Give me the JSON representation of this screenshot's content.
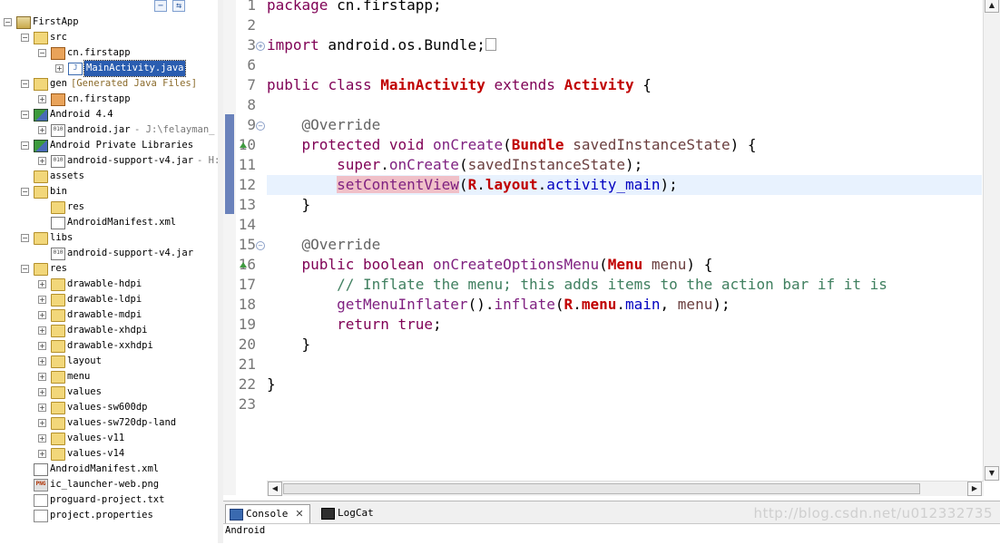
{
  "explorer": {
    "items": [
      {
        "label": "FirstApp",
        "depth": 0,
        "exp": "-",
        "icon": "project-icon",
        "cls": "i-proj"
      },
      {
        "label": "src",
        "depth": 1,
        "exp": "-",
        "icon": "source-folder-icon",
        "cls": "i-srcfolder"
      },
      {
        "label": "cn.firstapp",
        "depth": 2,
        "exp": "-",
        "icon": "package-icon",
        "cls": "i-pkg"
      },
      {
        "label": "MainActivity.java",
        "depth": 3,
        "exp": "+",
        "icon": "java-file-icon",
        "cls": "i-java",
        "selected": true
      },
      {
        "label": "gen",
        "depth": 1,
        "exp": "-",
        "icon": "source-folder-icon",
        "cls": "i-srcfolder",
        "decoration": "[Generated Java Files]"
      },
      {
        "label": "cn.firstapp",
        "depth": 2,
        "exp": "+",
        "icon": "package-icon",
        "cls": "i-pkg"
      },
      {
        "label": "Android 4.4",
        "depth": 1,
        "exp": "-",
        "icon": "library-icon",
        "cls": "i-lib"
      },
      {
        "label": "android.jar",
        "depth": 2,
        "exp": "+",
        "icon": "jar-icon",
        "cls": "i-jar",
        "decoration": "- J:\\felayman_"
      },
      {
        "label": "Android Private Libraries",
        "depth": 1,
        "exp": "-",
        "icon": "library-icon",
        "cls": "i-lib"
      },
      {
        "label": "android-support-v4.jar",
        "depth": 2,
        "exp": "+",
        "icon": "jar-icon",
        "cls": "i-jar",
        "decoration": "- H:"
      },
      {
        "label": "assets",
        "depth": 1,
        "exp": "",
        "icon": "folder-icon",
        "cls": "i-folder"
      },
      {
        "label": "bin",
        "depth": 1,
        "exp": "-",
        "icon": "folder-icon",
        "cls": "i-folder"
      },
      {
        "label": "res",
        "depth": 2,
        "exp": "",
        "icon": "folder-icon",
        "cls": "i-folder"
      },
      {
        "label": "AndroidManifest.xml",
        "depth": 2,
        "exp": "",
        "icon": "xml-file-icon",
        "cls": "i-xml"
      },
      {
        "label": "libs",
        "depth": 1,
        "exp": "-",
        "icon": "folder-icon",
        "cls": "i-folder"
      },
      {
        "label": "android-support-v4.jar",
        "depth": 2,
        "exp": "",
        "icon": "jar-icon",
        "cls": "i-jar"
      },
      {
        "label": "res",
        "depth": 1,
        "exp": "-",
        "icon": "folder-icon",
        "cls": "i-folder"
      },
      {
        "label": "drawable-hdpi",
        "depth": 2,
        "exp": "+",
        "icon": "folder-icon",
        "cls": "i-folder"
      },
      {
        "label": "drawable-ldpi",
        "depth": 2,
        "exp": "+",
        "icon": "folder-icon",
        "cls": "i-folder"
      },
      {
        "label": "drawable-mdpi",
        "depth": 2,
        "exp": "+",
        "icon": "folder-icon",
        "cls": "i-folder"
      },
      {
        "label": "drawable-xhdpi",
        "depth": 2,
        "exp": "+",
        "icon": "folder-icon",
        "cls": "i-folder"
      },
      {
        "label": "drawable-xxhdpi",
        "depth": 2,
        "exp": "+",
        "icon": "folder-icon",
        "cls": "i-folder"
      },
      {
        "label": "layout",
        "depth": 2,
        "exp": "+",
        "icon": "folder-icon",
        "cls": "i-folder"
      },
      {
        "label": "menu",
        "depth": 2,
        "exp": "+",
        "icon": "folder-icon",
        "cls": "i-folder"
      },
      {
        "label": "values",
        "depth": 2,
        "exp": "+",
        "icon": "folder-icon",
        "cls": "i-folder"
      },
      {
        "label": "values-sw600dp",
        "depth": 2,
        "exp": "+",
        "icon": "folder-icon",
        "cls": "i-folder"
      },
      {
        "label": "values-sw720dp-land",
        "depth": 2,
        "exp": "+",
        "icon": "folder-icon",
        "cls": "i-folder"
      },
      {
        "label": "values-v11",
        "depth": 2,
        "exp": "+",
        "icon": "folder-icon",
        "cls": "i-folder"
      },
      {
        "label": "values-v14",
        "depth": 2,
        "exp": "+",
        "icon": "folder-icon",
        "cls": "i-folder"
      },
      {
        "label": "AndroidManifest.xml",
        "depth": 1,
        "exp": "",
        "icon": "xml-file-icon",
        "cls": "i-xml"
      },
      {
        "label": "ic_launcher-web.png",
        "depth": 1,
        "exp": "",
        "icon": "png-file-icon",
        "cls": "i-png"
      },
      {
        "label": "proguard-project.txt",
        "depth": 1,
        "exp": "",
        "icon": "text-file-icon",
        "cls": "i-file"
      },
      {
        "label": "project.properties",
        "depth": 1,
        "exp": "",
        "icon": "text-file-icon",
        "cls": "i-file"
      }
    ]
  },
  "editor": {
    "lines": [
      {
        "n": "1",
        "tokens": [
          {
            "t": "package",
            "c": "kw"
          },
          {
            "t": " cn.firstapp;"
          }
        ]
      },
      {
        "n": "2",
        "tokens": []
      },
      {
        "n": "3",
        "fold": "+",
        "tokens": [
          {
            "t": "import",
            "c": "kw"
          },
          {
            "t": " android.os.Bundle;"
          },
          {
            "t": "",
            "c": "box"
          }
        ]
      },
      {
        "n": "6",
        "tokens": []
      },
      {
        "n": "7",
        "tokens": [
          {
            "t": "public",
            "c": "kw"
          },
          {
            "t": " "
          },
          {
            "t": "class",
            "c": "kw"
          },
          {
            "t": " "
          },
          {
            "t": "MainActivity",
            "c": "ty"
          },
          {
            "t": " "
          },
          {
            "t": "extends",
            "c": "kw"
          },
          {
            "t": " "
          },
          {
            "t": "Activity",
            "c": "ty"
          },
          {
            "t": " {"
          }
        ]
      },
      {
        "n": "8",
        "tokens": []
      },
      {
        "n": "9",
        "fold": "-",
        "tokens": [
          {
            "t": "    "
          },
          {
            "t": "@Override",
            "c": "an"
          }
        ]
      },
      {
        "n": "10",
        "tri": true,
        "tokens": [
          {
            "t": "    "
          },
          {
            "t": "protected",
            "c": "kw"
          },
          {
            "t": " "
          },
          {
            "t": "void",
            "c": "kw"
          },
          {
            "t": " "
          },
          {
            "t": "onCreate",
            "c": "fn"
          },
          {
            "t": "("
          },
          {
            "t": "Bundle",
            "c": "ty"
          },
          {
            "t": " "
          },
          {
            "t": "savedInstanceState",
            "c": "vr"
          },
          {
            "t": ") {"
          }
        ]
      },
      {
        "n": "11",
        "tokens": [
          {
            "t": "        "
          },
          {
            "t": "super",
            "c": "kw"
          },
          {
            "t": "."
          },
          {
            "t": "onCreate",
            "c": "fn"
          },
          {
            "t": "("
          },
          {
            "t": "savedInstanceState",
            "c": "vr"
          },
          {
            "t": ");"
          }
        ]
      },
      {
        "n": "12",
        "current": true,
        "tokens": [
          {
            "t": "        "
          },
          {
            "t": "setContentView",
            "c": "fn hl"
          },
          {
            "t": "("
          },
          {
            "t": "R",
            "c": "ty"
          },
          {
            "t": "."
          },
          {
            "t": "layout",
            "c": "ty"
          },
          {
            "t": "."
          },
          {
            "t": "activity_main",
            "c": "fd"
          },
          {
            "t": ");"
          }
        ]
      },
      {
        "n": "13",
        "tokens": [
          {
            "t": "    }"
          }
        ]
      },
      {
        "n": "14",
        "tokens": []
      },
      {
        "n": "15",
        "fold": "-",
        "tokens": [
          {
            "t": "    "
          },
          {
            "t": "@Override",
            "c": "an"
          }
        ]
      },
      {
        "n": "16",
        "tri": true,
        "tokens": [
          {
            "t": "    "
          },
          {
            "t": "public",
            "c": "kw"
          },
          {
            "t": " "
          },
          {
            "t": "boolean",
            "c": "kw"
          },
          {
            "t": " "
          },
          {
            "t": "onCreateOptionsMenu",
            "c": "fn"
          },
          {
            "t": "("
          },
          {
            "t": "Menu",
            "c": "ty"
          },
          {
            "t": " "
          },
          {
            "t": "menu",
            "c": "vr"
          },
          {
            "t": ") {"
          }
        ]
      },
      {
        "n": "17",
        "tokens": [
          {
            "t": "        "
          },
          {
            "t": "// Inflate the menu; this adds items to the action bar if it is",
            "c": "cm"
          }
        ]
      },
      {
        "n": "18",
        "tokens": [
          {
            "t": "        "
          },
          {
            "t": "getMenuInflater",
            "c": "fn"
          },
          {
            "t": "()."
          },
          {
            "t": "inflate",
            "c": "fn"
          },
          {
            "t": "("
          },
          {
            "t": "R",
            "c": "ty"
          },
          {
            "t": "."
          },
          {
            "t": "menu",
            "c": "ty"
          },
          {
            "t": "."
          },
          {
            "t": "main",
            "c": "fd"
          },
          {
            "t": ", "
          },
          {
            "t": "menu",
            "c": "vr"
          },
          {
            "t": ");"
          }
        ]
      },
      {
        "n": "19",
        "tokens": [
          {
            "t": "        "
          },
          {
            "t": "return",
            "c": "kw"
          },
          {
            "t": " "
          },
          {
            "t": "true",
            "c": "kw"
          },
          {
            "t": ";"
          }
        ]
      },
      {
        "n": "20",
        "tokens": [
          {
            "t": "    }"
          }
        ]
      },
      {
        "n": "21",
        "tokens": []
      },
      {
        "n": "22",
        "tokens": [
          {
            "t": "}"
          }
        ]
      },
      {
        "n": "23",
        "tokens": []
      }
    ]
  },
  "bottom": {
    "tabs": [
      {
        "label": "Console",
        "close": "✕",
        "active": true
      },
      {
        "label": "LogCat",
        "active": false
      }
    ],
    "console_name": "Android",
    "watermark": "http://blog.csdn.net/u012332735"
  },
  "colors": {
    "selection": "#2a5db0",
    "current_line": "#e8f2fe",
    "keyword": "#7f0055",
    "type": "#c00000"
  }
}
